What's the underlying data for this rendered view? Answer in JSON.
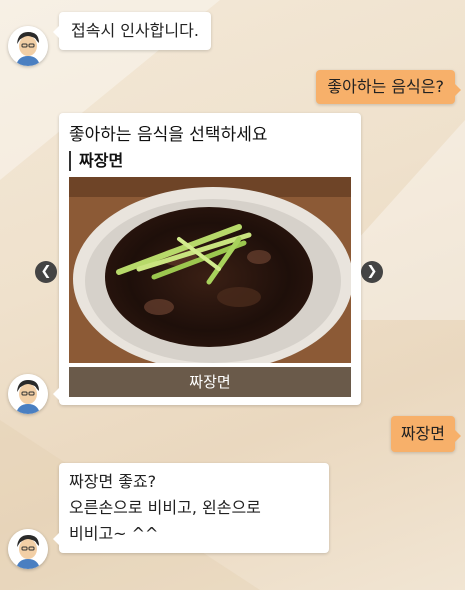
{
  "messages": {
    "bot_greeting": "접속시 인사합니다.",
    "user_question": "좋아하는 음식은?",
    "card": {
      "title": "좋아하는 음식을 선택하세요",
      "subtitle": "짜장면",
      "button_label": "짜장면",
      "image_label": "jajangmyeon-photo"
    },
    "user_answer": "짜장면",
    "bot_reply_lines": [
      "짜장면 좋죠?",
      "오른손으로 비비고, 왼손으로",
      "비비고~ ^^"
    ]
  },
  "icons": {
    "prev": "chevron-left-icon",
    "next": "chevron-right-icon",
    "avatar": "bot-avatar"
  },
  "colors": {
    "user_bubble": "#f7b06a",
    "bot_bubble": "#ffffff",
    "card_button": "#6a5a4a",
    "nav_button": "#444444"
  }
}
